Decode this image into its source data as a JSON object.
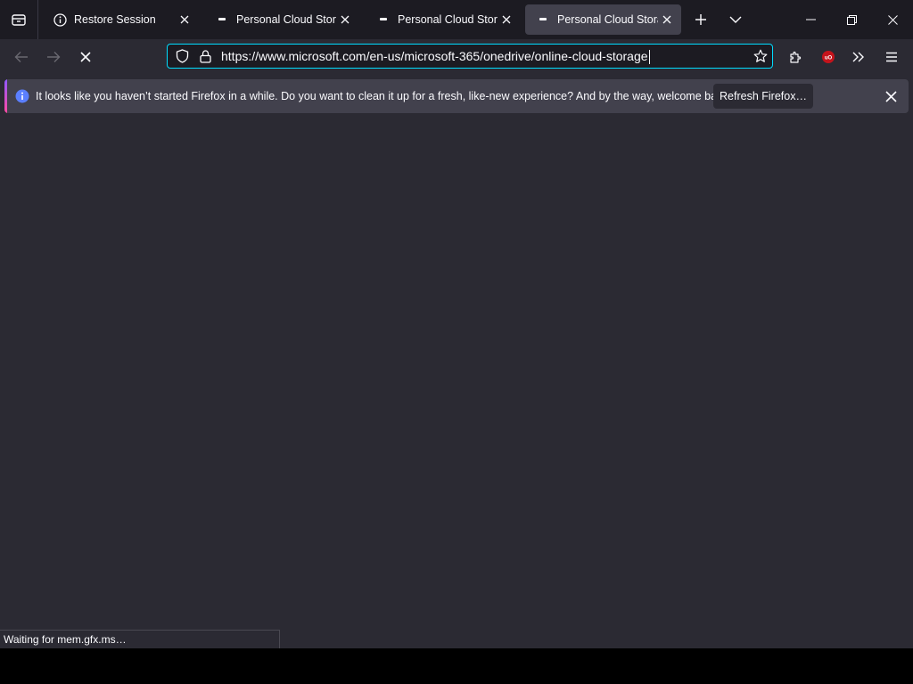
{
  "tabs": [
    {
      "title": "Restore Session",
      "icon": "info-icon",
      "active": false
    },
    {
      "title": "Personal Cloud Storage – Microsoft OneDrive",
      "icon": "page-icon",
      "active": false
    },
    {
      "title": "Personal Cloud Storage – Microsoft OneDrive",
      "icon": "page-icon",
      "active": false
    },
    {
      "title": "Personal Cloud Storage – Microsoft OneDrive",
      "icon": "page-icon",
      "active": true
    }
  ],
  "navbar": {
    "url": "https://www.microsoft.com/en-us/microsoft-365/onedrive/online-cloud-storage"
  },
  "notification": {
    "message": "It looks like you haven’t started Firefox in a while. Do you want to clean it up for a fresh, like-new experience? And by the way, welcome back!",
    "button_label": "Refresh Firefox…"
  },
  "status": {
    "text": "Waiting for mem.gfx.ms…"
  },
  "colors": {
    "accent": "#00ddff",
    "tabstrip_bg": "#1c1b22",
    "toolbar_bg": "#2b2a33",
    "ublock_red": "#c4141c"
  }
}
